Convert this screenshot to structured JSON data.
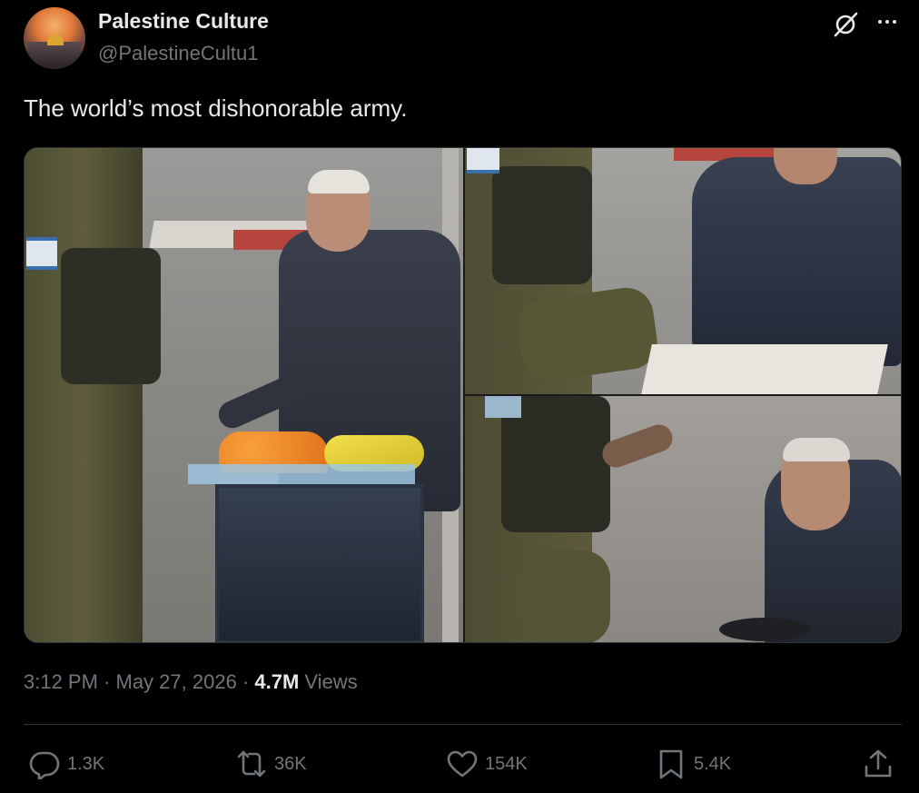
{
  "author": {
    "name": "Palestine Culture",
    "handle": "@PalestineCultu1"
  },
  "tweet": {
    "text": "The world’s most dishonorable army."
  },
  "meta": {
    "time": "3:12 PM",
    "sep1": " · ",
    "date": "May 27, 2026",
    "sep2": " · ",
    "views_count": "4.7M",
    "views_label": " Views"
  },
  "actions": {
    "replies": "1.3K",
    "reposts": "36K",
    "likes": "154K",
    "bookmarks": "5.4K"
  },
  "icons": {
    "grok": "grok-icon",
    "more": "more-icon",
    "reply": "reply-icon",
    "repost": "repost-icon",
    "like": "like-icon",
    "bookmark": "bookmark-icon",
    "share": "share-icon"
  },
  "colors": {
    "background": "#000000",
    "text_primary": "#e7e9ea",
    "text_secondary": "#71767b",
    "border": "#2f3336"
  }
}
